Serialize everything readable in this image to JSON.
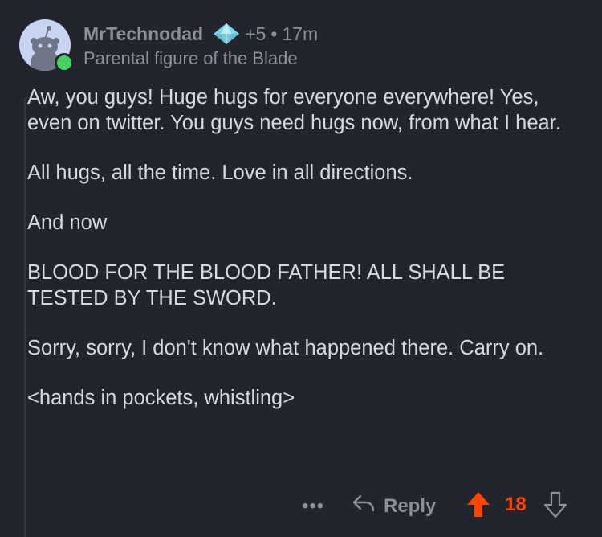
{
  "comment": {
    "username": "MrTechnodad",
    "karma_delta": "+5",
    "separator": "•",
    "age": "17m",
    "user_flair": "Parental figure of the Blade",
    "paragraphs": [
      "Aw, you guys! Huge hugs for everyone everywhere! Yes, even on twitter. You guys need hugs now, from what I hear.",
      "All hugs, all the time. Love in all directions.",
      "And now",
      "BLOOD FOR THE BLOOD FATHER! ALL SHALL BE TESTED BY THE SWORD.",
      "Sorry, sorry, I don't know what happened there. Carry on.",
      "<hands in pockets, whistling>"
    ]
  },
  "actions": {
    "more_label": "•••",
    "reply_label": "Reply",
    "score": "18"
  },
  "icons": {
    "avatar": "snoo-avatar-icon",
    "flair": "diamond-award-icon",
    "reply": "reply-arrow-icon",
    "upvote": "upvote-arrow-icon",
    "downvote": "downvote-arrow-icon"
  },
  "colors": {
    "background": "#22252e",
    "text": "#d7dadc",
    "muted": "#8d909a",
    "upvote": "#ff4500",
    "online": "#46d160"
  }
}
